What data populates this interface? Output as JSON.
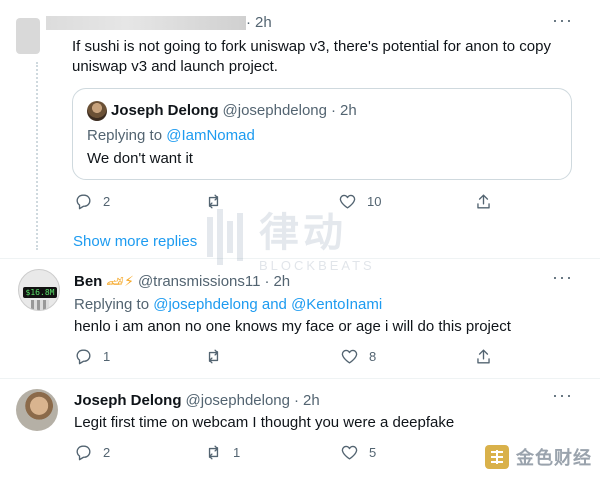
{
  "tweet1": {
    "time": "2h",
    "text": "If sushi is not going to fork uniswap v3, there's potential for anon to copy uniswap v3 and launch project.",
    "actions": {
      "reply": "2",
      "retweet": "",
      "like": "10"
    }
  },
  "quote": {
    "name": "Joseph Delong",
    "handle": "@josephdelong",
    "dot": "·",
    "time": "2h",
    "replying_prefix": "Replying to",
    "replying_to": "@IamNomad",
    "text": "We don't want it"
  },
  "show_more": "Show more replies",
  "tweet2": {
    "name": "Ben",
    "emoji": "🏎⚡",
    "handle": "@transmissions11",
    "dot": "·",
    "time": "2h",
    "replying_prefix": "Replying to",
    "replying_to_1": "@josephdelong",
    "and": "and",
    "replying_to_2": "@KentoInami",
    "avatar_text": "$16.8M",
    "text": "henlo i am anon no one knows my face or age i will do this project",
    "actions": {
      "reply": "1",
      "retweet": "",
      "like": "8"
    }
  },
  "tweet3": {
    "name": "Joseph Delong",
    "handle": "@josephdelong",
    "dot": "·",
    "time": "2h",
    "text": "Legit first time on webcam I thought you were a deepfake",
    "actions": {
      "reply": "2",
      "retweet": "1",
      "like": "5"
    }
  },
  "more_label": "···",
  "watermark": {
    "cn": "律动",
    "en": "BLOCKBEATS"
  },
  "corner_brand": "金色财经",
  "colors": {
    "accent": "#1d9bf0",
    "muted": "#536471",
    "border": "#cfd9de"
  }
}
